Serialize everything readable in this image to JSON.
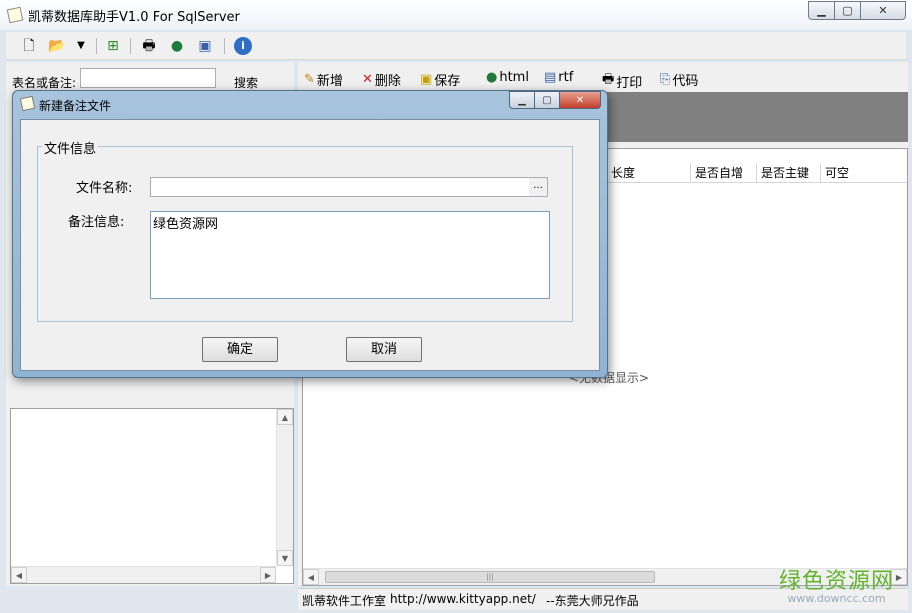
{
  "window": {
    "title": "凯蒂数据库助手V1.0 For SqlServer",
    "min": "▭",
    "restore": "◻",
    "close": "✕"
  },
  "toolbar": {
    "icons": [
      "new-file-icon",
      "open-folder-icon",
      "dropdown-arrow-icon",
      "add-table-icon",
      "print-icon",
      "globe-icon",
      "document-icon",
      "info-icon"
    ]
  },
  "left": {
    "search_label": "表名或备注:",
    "search_value": "",
    "search_button": "搜索"
  },
  "right_toolbar": {
    "new": "新增",
    "delete": "删除",
    "save": "保存",
    "html": "html",
    "rtf": "rtf",
    "print": "打印",
    "code": "代码"
  },
  "grid": {
    "columns": [
      "长度",
      "是否自增",
      "是否主键",
      "可空"
    ],
    "empty_text": "<无数据显示>"
  },
  "status": {
    "studio": "凯蒂软件工作室",
    "url": "http://www.kittyapp.net/",
    "author": "--东莞大师兄作品"
  },
  "watermark": {
    "cn": "绿色资源网",
    "en": "www.downcc.com"
  },
  "dialog": {
    "title": "新建备注文件",
    "group_label": "文件信息",
    "filename_label": "文件名称:",
    "filename_value": "",
    "browse": "...",
    "note_label": "备注信息:",
    "note_value": "绿色资源网",
    "ok": "确定",
    "cancel": "取消"
  }
}
